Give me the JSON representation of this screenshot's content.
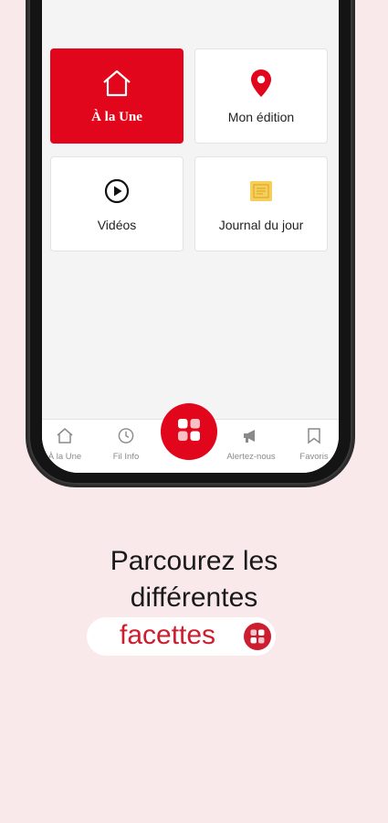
{
  "tiles": [
    {
      "label": "À la Une",
      "icon": "home-icon",
      "active": true
    },
    {
      "label": "Mon édition",
      "icon": "location-pin-icon"
    },
    {
      "label": "Vidéos",
      "icon": "play-icon"
    },
    {
      "label": "Journal du jour",
      "icon": "newspaper-icon"
    }
  ],
  "tabbar": {
    "items": [
      {
        "label": "À la Une",
        "icon": "home-icon"
      },
      {
        "label": "Fil Info",
        "icon": "clock-icon"
      },
      {
        "label": "",
        "icon": "grid-icon"
      },
      {
        "label": "Alertez-nous",
        "icon": "megaphone-icon"
      },
      {
        "label": "Favoris",
        "icon": "bookmark-icon"
      }
    ]
  },
  "promo": {
    "line1": "Parcourez les",
    "line2": "différentes",
    "highlight": "facettes"
  },
  "colors": {
    "accent": "#e1061b",
    "background": "#f9e9ea",
    "promo_red": "#cc1e2f",
    "journal_icon": "#f0c040"
  }
}
